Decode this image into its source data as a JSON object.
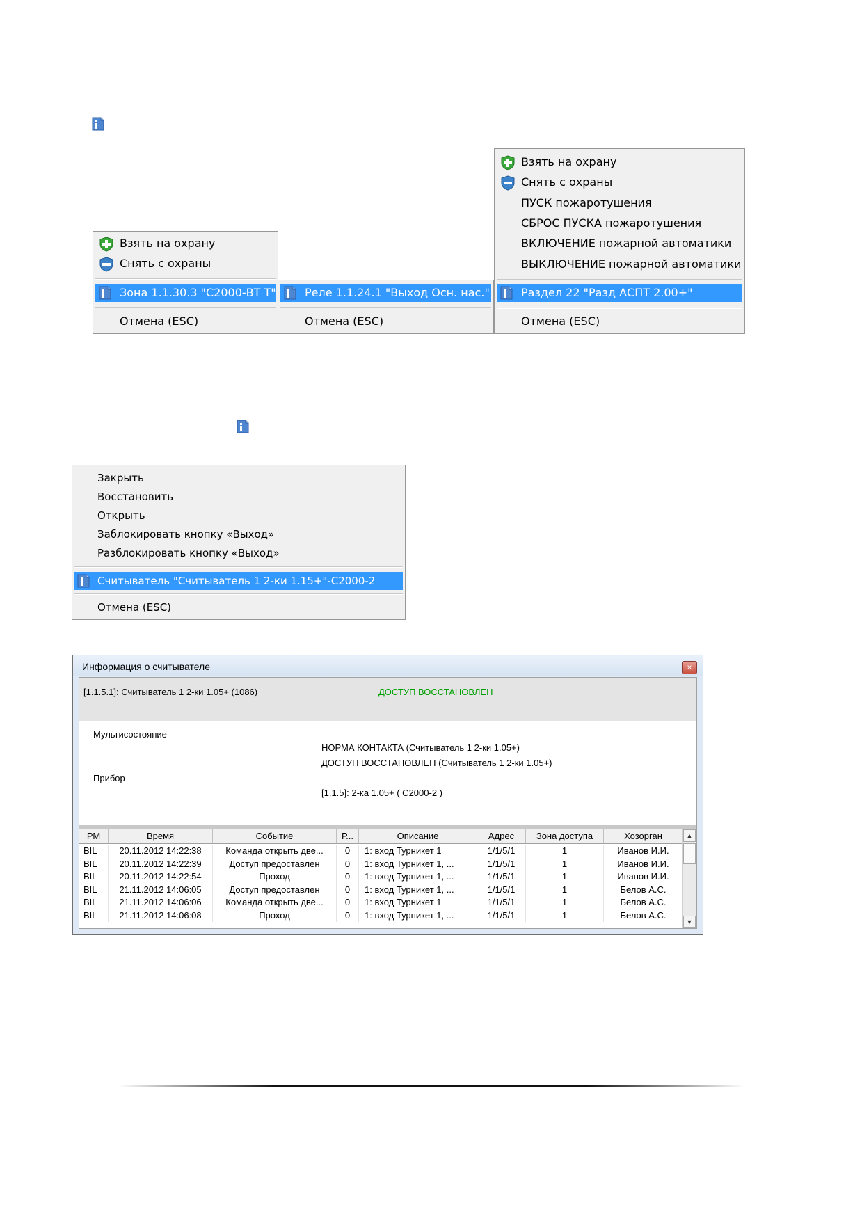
{
  "colors": {
    "selection": "#3399ff",
    "status_green": "#00a000",
    "menu_bg": "#f0f0f0"
  },
  "menu_left": {
    "items": [
      {
        "label": "Взять на охрану",
        "icon": "arm-green-shield-icon"
      },
      {
        "label": "Снять с охраны",
        "icon": "disarm-blue-shield-icon"
      }
    ],
    "selected": {
      "label": "Зона 1.1.30.3 \"С2000-ВТ Т\"",
      "icon": "info-icon"
    },
    "cancel": "Отмена (ESC)"
  },
  "menu_middle": {
    "selected": {
      "label": "Реле 1.1.24.1 \"Выход Осн. нас.\"",
      "icon": "info-icon"
    },
    "cancel": "Отмена (ESC)"
  },
  "menu_right": {
    "items": [
      {
        "label": "Взять на охрану",
        "icon": "arm-green-shield-icon"
      },
      {
        "label": "Снять с охраны",
        "icon": "disarm-blue-shield-icon"
      },
      {
        "label": "ПУСК пожаротушения"
      },
      {
        "label": "СБРОС ПУСКА пожаротушения"
      },
      {
        "label": "ВКЛЮЧЕНИЕ пожарной автоматики"
      },
      {
        "label": "ВЫКЛЮЧЕНИЕ пожарной автоматики"
      }
    ],
    "selected": {
      "label": "Раздел 22  \"Разд АСПТ 2.00+\"",
      "icon": "info-icon"
    },
    "cancel": "Отмена (ESC)"
  },
  "menu_reader": {
    "items": [
      {
        "label": "Закрыть"
      },
      {
        "label": "Восстановить"
      },
      {
        "label": "Открыть"
      },
      {
        "label": "Заблокировать кнопку «Выход»"
      },
      {
        "label": "Разблокировать кнопку «Выход»"
      }
    ],
    "selected": {
      "label": "Считыватель \"Считыватель 1 2-ки 1.15+\"-С2000-2",
      "icon": "info-icon"
    },
    "cancel": "Отмена (ESC)"
  },
  "window": {
    "title": "Информация о считывателе",
    "close": "×",
    "header_left": "[1.1.5.1]: Считыватель 1 2-ки 1.05+ (1086)",
    "header_status": "ДОСТУП ВОССТАНОВЛЕН",
    "multistate_label": "Мультисостояние",
    "multistate_values": [
      "НОРМА КОНТАКТА (Считыватель 1 2-ки 1.05+)",
      "ДОСТУП ВОССТАНОВЛЕН (Считыватель 1 2-ки 1.05+)"
    ],
    "device_label": "Прибор",
    "device_value": "[1.1.5]: 2-ка 1.05+ ( С2000-2 )",
    "columns": [
      "РМ",
      "Время",
      "Событие",
      "Р...",
      "Описание",
      "Адрес",
      "Зона доступа",
      "Хозорган"
    ],
    "rows": [
      [
        "BIL",
        "20.11.2012 14:22:38",
        "Команда открыть две...",
        "0",
        "1: вход   Турникет 1",
        "1/1/5/1",
        "1",
        "Иванов И.И."
      ],
      [
        "BIL",
        "20.11.2012 14:22:39",
        "Доступ предоставлен",
        "0",
        "1: вход   Турникет 1, ...",
        "1/1/5/1",
        "1",
        "Иванов И.И."
      ],
      [
        "BIL",
        "20.11.2012 14:22:54",
        "Проход",
        "0",
        "1: вход   Турникет 1, ...",
        "1/1/5/1",
        "1",
        "Иванов И.И."
      ],
      [
        "BIL",
        "21.11.2012 14:06:05",
        "Доступ предоставлен",
        "0",
        "1: вход   Турникет 1, ...",
        "1/1/5/1",
        "1",
        "Белов А.С."
      ],
      [
        "BIL",
        "21.11.2012 14:06:06",
        "Команда открыть две...",
        "0",
        "1: вход   Турникет 1",
        "1/1/5/1",
        "1",
        "Белов А.С."
      ],
      [
        "BIL",
        "21.11.2012 14:06:08",
        "Проход",
        "0",
        "1: вход   Турникет 1, ...",
        "1/1/5/1",
        "1",
        "Белов А.С."
      ]
    ],
    "scroll_up": "▲",
    "scroll_down": "▼"
  }
}
